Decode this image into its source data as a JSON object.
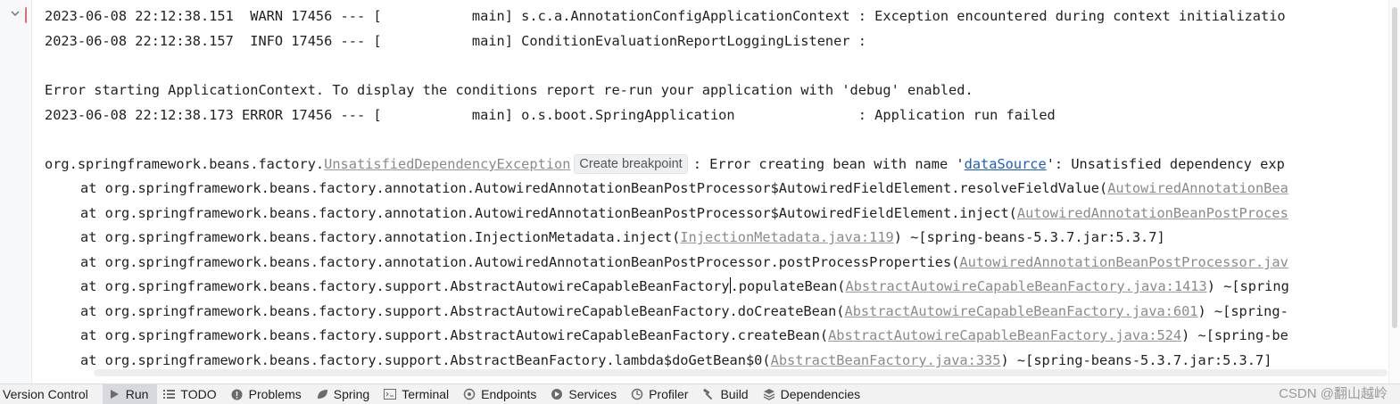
{
  "log_lines": [
    {
      "text": "2023-06-08 22:12:38.151  WARN 17456 --- [           main] s.c.a.AnnotationConfigApplicationContext : Exception encountered during context initializatio"
    },
    {
      "text": "2023-06-08 22:12:38.157  INFO 17456 --- [           main] ConditionEvaluationReportLoggingListener :"
    },
    {
      "text": "Error starting ApplicationContext. To display the conditions report re-run your application with 'debug' enabled."
    },
    {
      "text": "2023-06-08 22:12:38.173 ERROR 17456 --- [           main] o.s.boot.SpringApplication               : Application run failed"
    }
  ],
  "exception_line": {
    "prefix": "org.springframework.beans.factory.",
    "exception_link": "UnsatisfiedDependencyException",
    "breakpoint_label": "Create breakpoint",
    "middle": ": Error creating bean with name '",
    "bean_link": "dataSource",
    "suffix": "': Unsatisfied dependency exp"
  },
  "stack_lines": [
    {
      "prefix": "at org.springframework.beans.factory.annotation.AutowiredAnnotationBeanPostProcessor$AutowiredFieldElement.resolveFieldValue(",
      "link": "AutowiredAnnotationBea",
      "suffix": ""
    },
    {
      "prefix": "at org.springframework.beans.factory.annotation.AutowiredAnnotationBeanPostProcessor$AutowiredFieldElement.inject(",
      "link": "AutowiredAnnotationBeanPostProces",
      "suffix": ""
    },
    {
      "prefix": "at org.springframework.beans.factory.annotation.InjectionMetadata.inject(",
      "link": "InjectionMetadata.java:119",
      "suffix": ") ~[spring-beans-5.3.7.jar:5.3.7]"
    },
    {
      "prefix": "at org.springframework.beans.factory.annotation.AutowiredAnnotationBeanPostProcessor.postProcessProperties(",
      "link": "AutowiredAnnotationBeanPostProcessor.jav",
      "suffix": ""
    },
    {
      "prefix_a": "at org.springframework.beans.factory.support.AbstractAutowireCapableBeanFactory",
      "prefix_b": ".populateBean(",
      "link": "AbstractAutowireCapableBeanFactory.java:1413",
      "suffix": ") ~[spring"
    },
    {
      "prefix": "at org.springframework.beans.factory.support.AbstractAutowireCapableBeanFactory.doCreateBean(",
      "link": "AbstractAutowireCapableBeanFactory.java:601",
      "suffix": ") ~[spring-"
    },
    {
      "prefix": "at org.springframework.beans.factory.support.AbstractAutowireCapableBeanFactory.createBean(",
      "link": "AbstractAutowireCapableBeanFactory.java:524",
      "suffix": ") ~[spring-be"
    },
    {
      "prefix": "at org.springframework.beans.factory.support.AbstractBeanFactory.lambda$doGetBean$0(",
      "link": "AbstractBeanFactory.java:335",
      "suffix": ") ~[spring-beans-5.3.7.jar:5.3.7]"
    }
  ],
  "toolbar": {
    "items": [
      {
        "label": "Version Control",
        "icon": "none"
      },
      {
        "label": "Run",
        "icon": "play-icon",
        "active": true
      },
      {
        "label": "TODO",
        "icon": "list-icon"
      },
      {
        "label": "Problems",
        "icon": "info-icon"
      },
      {
        "label": "Spring",
        "icon": "leaf-icon"
      },
      {
        "label": "Terminal",
        "icon": "terminal-icon"
      },
      {
        "label": "Endpoints",
        "icon": "endpoints-icon"
      },
      {
        "label": "Services",
        "icon": "services-icon"
      },
      {
        "label": "Profiler",
        "icon": "profiler-icon"
      },
      {
        "label": "Build",
        "icon": "hammer-icon"
      },
      {
        "label": "Dependencies",
        "icon": "stack-icon"
      }
    ]
  },
  "watermark": "CSDN @翻山越岭",
  "colors": {
    "link_gray": "#8a8a8a",
    "link_blue": "#1a5dc2",
    "active_tool_bg": "#d7d9de"
  }
}
